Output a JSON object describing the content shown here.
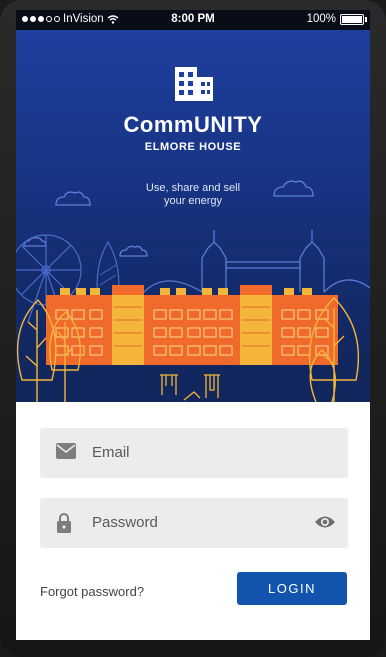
{
  "status_bar": {
    "carrier": "InVision",
    "time": "8:00 PM",
    "battery": "100%",
    "signal_icon": "signal-dots-icon",
    "wifi_icon": "wifi-icon",
    "battery_icon": "battery-icon"
  },
  "hero": {
    "title": "CommUNITY",
    "subtitle": "ELMORE HOUSE",
    "tagline_line1": "Use, share and sell",
    "tagline_line2": "your energy",
    "logo_icon": "building-icon"
  },
  "form": {
    "email_placeholder": "Email",
    "password_placeholder": "Password",
    "email_icon": "envelope-icon",
    "password_icon": "lock-icon",
    "reveal_icon": "eye-icon",
    "forgot_label": "Forgot password?",
    "login_label": "LOGIN"
  },
  "colors": {
    "hero_top": "#1d3f9e",
    "hero_bottom": "#0f2455",
    "building": "#f06a2b",
    "accent_yellow": "#f3b63a",
    "login_button": "#1254ad",
    "field_bg": "#ececec"
  }
}
